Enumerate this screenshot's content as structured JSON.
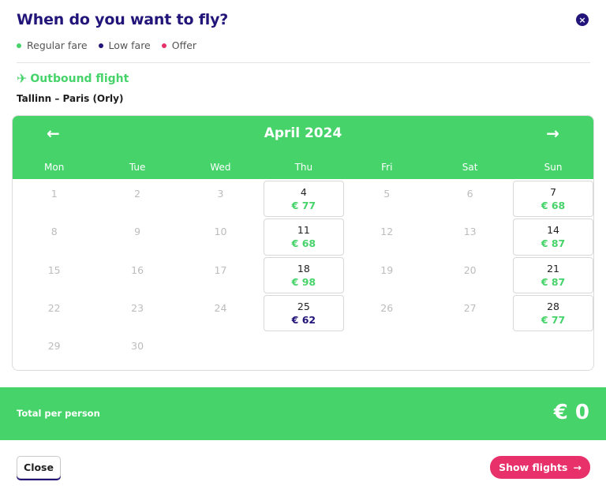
{
  "header": {
    "title": "When do you want to fly?",
    "close_icon": "×"
  },
  "legend": [
    {
      "label": "Regular fare",
      "color": "#46d36a"
    },
    {
      "label": "Low fare",
      "color": "#22157a"
    },
    {
      "label": "Offer",
      "color": "#e8306b"
    }
  ],
  "flight": {
    "section": "Outbound flight",
    "route": "Tallinn – Paris (Orly)"
  },
  "calendar": {
    "month": "April 2024",
    "prev_icon": "←",
    "next_icon": "→",
    "weekdays": [
      "Mon",
      "Tue",
      "Wed",
      "Thu",
      "Fri",
      "Sat",
      "Sun"
    ],
    "days": [
      {
        "d": "1"
      },
      {
        "d": "2"
      },
      {
        "d": "3"
      },
      {
        "d": "4",
        "price": "€ 77",
        "fare": "regular"
      },
      {
        "d": "5"
      },
      {
        "d": "6"
      },
      {
        "d": "7",
        "price": "€ 68",
        "fare": "regular"
      },
      {
        "d": "8"
      },
      {
        "d": "9"
      },
      {
        "d": "10"
      },
      {
        "d": "11",
        "price": "€ 68",
        "fare": "regular"
      },
      {
        "d": "12"
      },
      {
        "d": "13"
      },
      {
        "d": "14",
        "price": "€ 87",
        "fare": "regular"
      },
      {
        "d": "15"
      },
      {
        "d": "16"
      },
      {
        "d": "17"
      },
      {
        "d": "18",
        "price": "€ 98",
        "fare": "regular"
      },
      {
        "d": "19"
      },
      {
        "d": "20"
      },
      {
        "d": "21",
        "price": "€ 87",
        "fare": "regular"
      },
      {
        "d": "22"
      },
      {
        "d": "23"
      },
      {
        "d": "24"
      },
      {
        "d": "25",
        "price": "€ 62",
        "fare": "low"
      },
      {
        "d": "26"
      },
      {
        "d": "27"
      },
      {
        "d": "28",
        "price": "€ 77",
        "fare": "regular"
      },
      {
        "d": "29"
      },
      {
        "d": "30"
      }
    ]
  },
  "total": {
    "label": "Total per person",
    "value": "€ 0"
  },
  "footer": {
    "close_label": "Close",
    "show_label": "Show flights",
    "show_icon": "→"
  },
  "colors": {
    "accent": "#46d36a",
    "brand": "#22157a",
    "offer": "#e8306b"
  }
}
